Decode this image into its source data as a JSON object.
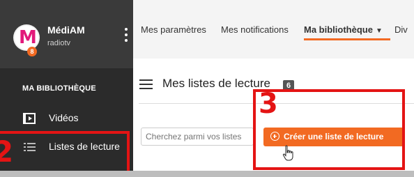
{
  "sidebar": {
    "logo_letter": "M",
    "logo_badge": "8",
    "app_name": "MédiAM",
    "app_sub": "radiotv",
    "section_title": "MA BIBLIOTHÈQUE",
    "items": [
      {
        "label": "Vidéos",
        "icon": "video-icon"
      },
      {
        "label": "Listes de lecture",
        "icon": "list-icon"
      }
    ]
  },
  "topnav": {
    "tabs": [
      {
        "label": "Mes paramètres"
      },
      {
        "label": "Mes notifications"
      },
      {
        "label": "Ma bibliothèque",
        "active": true
      },
      {
        "label": "Div"
      }
    ]
  },
  "main": {
    "title": "Mes listes de lecture",
    "count": "6",
    "search_placeholder": "Cherchez parmi vos listes",
    "create_label": "Créer une liste de lecture"
  },
  "annotations": {
    "step_2": "2",
    "step_3": "3"
  },
  "colors": {
    "accent": "#f26a22",
    "sidebar_bg": "#2b2b2b",
    "annotation": "#e41414",
    "logo_pink": "#e2197a"
  }
}
